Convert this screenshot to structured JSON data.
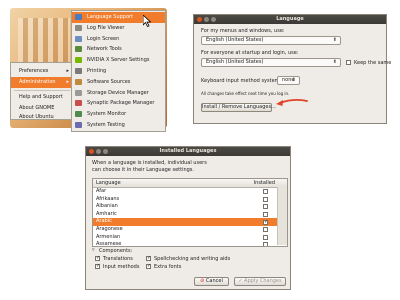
{
  "menu": {
    "system_items": [
      {
        "label": "Preferences",
        "has_submenu": true
      },
      {
        "label": "Administration",
        "has_submenu": true,
        "selected": true
      },
      {
        "label": "Help and Support"
      },
      {
        "label": "About GNOME"
      },
      {
        "label": "About Ubuntu"
      }
    ],
    "submenu_arrow": "▸",
    "admin_items": [
      {
        "label": "Language Support",
        "selected": true,
        "icon": "flag-icon"
      },
      {
        "label": "Log File Viewer",
        "icon": "log-icon"
      },
      {
        "label": "Login Screen",
        "icon": "login-icon"
      },
      {
        "label": "Network Tools",
        "icon": "network-icon"
      },
      {
        "label": "NVIDIA X Server Settings",
        "icon": "nvidia-icon"
      },
      {
        "label": "Printing",
        "icon": "printer-icon"
      },
      {
        "label": "Software Sources",
        "icon": "software-icon"
      },
      {
        "label": "Storage Device Manager",
        "icon": "storage-icon"
      },
      {
        "label": "Synaptic Package Manager",
        "icon": "package-icon"
      },
      {
        "label": "System Monitor",
        "icon": "monitor-icon"
      },
      {
        "label": "System Testing",
        "icon": "testing-icon"
      }
    ]
  },
  "language_dialog": {
    "title": "Language",
    "menus_label": "For my menus and windows, use:",
    "menus_value": "English (United States)",
    "startup_label": "For everyone at startup and login, use:",
    "startup_value": "English (United States)",
    "keep_same_label": "Keep the same",
    "keep_same_checked": false,
    "input_method_label": "Keyboard input method system:",
    "input_method_value": "none",
    "note": "All changes take effect next time you log in.",
    "install_button": "Install / Remove Languages..."
  },
  "installed_dialog": {
    "title": "Installed Languages",
    "intro_line1": "When a language is installed, individual users",
    "intro_line2": "can choose it in their Language settings.",
    "col_language": "Language",
    "col_installed": "Installed",
    "languages": [
      {
        "name": "Afar",
        "installed": false
      },
      {
        "name": "Afrikaans",
        "installed": false
      },
      {
        "name": "Albanian",
        "installed": false
      },
      {
        "name": "Amharic",
        "installed": false
      },
      {
        "name": "Arabic",
        "installed": true,
        "selected": true
      },
      {
        "name": "Aragonese",
        "installed": false
      },
      {
        "name": "Armenian",
        "installed": false
      },
      {
        "name": "Assamese",
        "installed": false
      }
    ],
    "components_label": "Components:",
    "translations": "Translations",
    "input_methods": "Input methods",
    "spellcheck": "Spellchecking and writing aids",
    "extra_fonts": "Extra fonts",
    "cancel_button": "Cancel",
    "apply_button": "Apply Changes"
  },
  "colors": {
    "accent": "#f07c2c",
    "arrow": "#e0432a"
  }
}
